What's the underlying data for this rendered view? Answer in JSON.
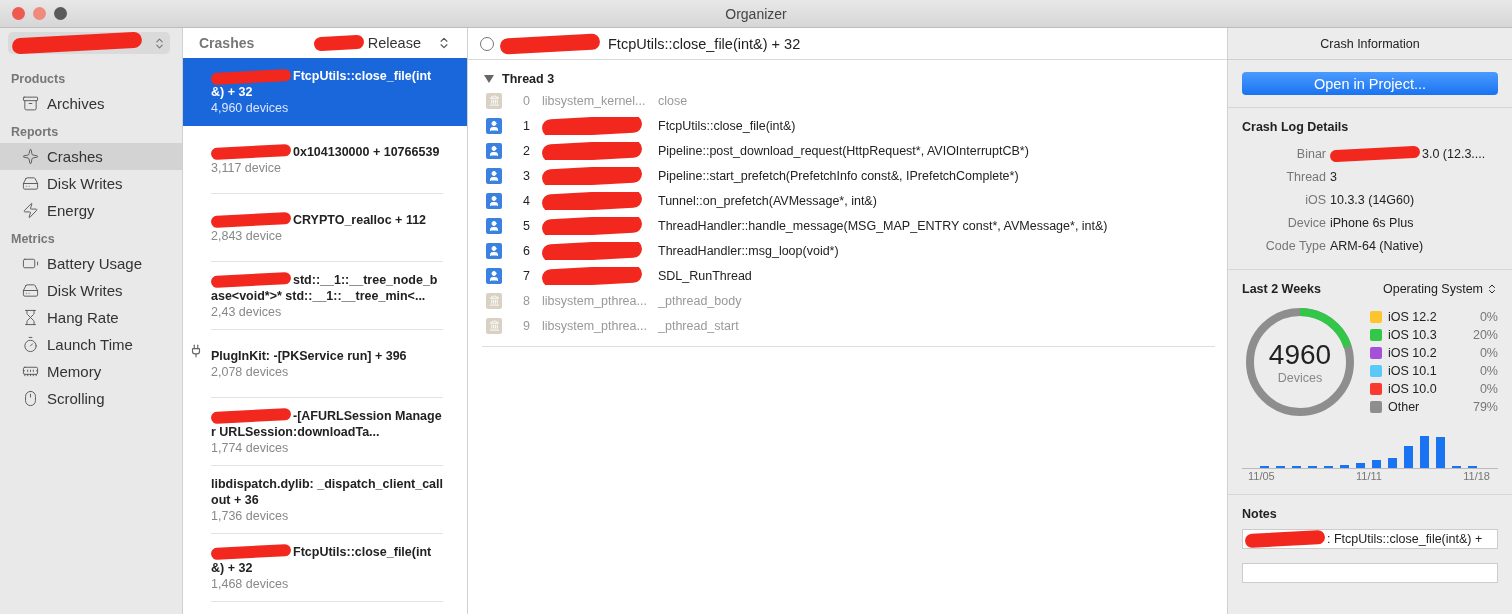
{
  "window": {
    "title": "Organizer",
    "buttons": [
      {
        "color": "#ee5a52"
      },
      {
        "color": "#f08a7c"
      },
      {
        "color": "#5a5a5a"
      }
    ]
  },
  "sidebar": {
    "scheme_popup": {
      "redacted": true
    },
    "sections": [
      {
        "title": "Products",
        "items": [
          {
            "label": "Archives",
            "kind": "archive",
            "selected": false
          }
        ]
      },
      {
        "title": "Reports",
        "items": [
          {
            "label": "Crashes",
            "kind": "crash",
            "selected": true
          },
          {
            "label": "Disk Writes",
            "kind": "disk",
            "selected": false
          },
          {
            "label": "Energy",
            "kind": "energy",
            "selected": false
          }
        ]
      },
      {
        "title": "Metrics",
        "items": [
          {
            "label": "Battery Usage",
            "kind": "battery",
            "selected": false
          },
          {
            "label": "Disk Writes",
            "kind": "disk",
            "selected": false
          },
          {
            "label": "Hang Rate",
            "kind": "hourglass",
            "selected": false
          },
          {
            "label": "Launch Time",
            "kind": "timer",
            "selected": false
          },
          {
            "label": "Memory",
            "kind": "memory",
            "selected": false
          },
          {
            "label": "Scrolling",
            "kind": "scroll",
            "selected": false
          }
        ]
      }
    ]
  },
  "crash_list": {
    "title": "Crashes",
    "filter": {
      "label": "Release",
      "redacted": true
    },
    "items": [
      {
        "title": "FtcpUtils::close_file(int&) + 32",
        "devices": "4,960 devices",
        "selected": true,
        "redacted": true
      },
      {
        "title": "0x104130000 + 10766539",
        "devices": "3,117 device",
        "selected": false,
        "redacted": true
      },
      {
        "title": "CRYPTO_realloc + 112",
        "devices": "2,843 device",
        "selected": false,
        "redacted": true
      },
      {
        "title": "std::__1::__tree_node_base<void*>* std::__1::__tree_min<...",
        "devices": "2,43 devices",
        "selected": false,
        "redacted": true
      },
      {
        "title": "PlugInKit: -[PKService run] + 396",
        "devices": "2,078 devices",
        "selected": false,
        "redacted": false,
        "plugin": true
      },
      {
        "title": "-[AFURLSession Manager URLSession:downloadTa...",
        "devices": "1,774 devices",
        "selected": false,
        "redacted": true
      },
      {
        "title": "libdispatch.dylib: _dispatch_client_callout + 36",
        "devices": "1,736 devices",
        "selected": false,
        "redacted": false
      },
      {
        "title": "FtcpUtils::close_file(int&) + 32",
        "devices": "1,468 devices",
        "selected": false,
        "redacted": true
      }
    ]
  },
  "detail": {
    "header": {
      "title": "FtcpUtils::close_file(int&) + 32",
      "redacted": true,
      "checked": false
    },
    "thread": {
      "title": "Thread 3",
      "expanded": true,
      "frames": [
        {
          "index": "0",
          "kind": "system",
          "library": "libsystem_kernel...",
          "symbol": "close"
        },
        {
          "index": "1",
          "kind": "user",
          "redacted": true,
          "symbol": "FtcpUtils::close_file(int&)"
        },
        {
          "index": "2",
          "kind": "user",
          "redacted": true,
          "symbol": "Pipeline::post_download_request(HttpRequest*, AVIOInterruptCB*)"
        },
        {
          "index": "3",
          "kind": "user",
          "redacted": true,
          "symbol": "Pipeline::start_prefetch(PrefetchInfo const&, IPrefetchComplete*)"
        },
        {
          "index": "4",
          "kind": "user",
          "redacted": true,
          "symbol": "Tunnel::on_prefetch(AVMessage*, int&)"
        },
        {
          "index": "5",
          "kind": "user",
          "redacted": true,
          "symbol": "ThreadHandler::handle_message(MSG_MAP_ENTRY const*, AVMessage*, int&)"
        },
        {
          "index": "6",
          "kind": "user",
          "redacted": true,
          "symbol": "ThreadHandler::msg_loop(void*)"
        },
        {
          "index": "7",
          "kind": "user",
          "redacted": true,
          "symbol": "SDL_RunThread"
        },
        {
          "index": "8",
          "kind": "system",
          "library": "libsystem_pthrea...",
          "symbol": "_pthread_body"
        },
        {
          "index": "9",
          "kind": "system",
          "library": "libsystem_pthrea...",
          "symbol": "_pthread_start"
        }
      ]
    }
  },
  "inspector": {
    "title": "Crash Information",
    "open_button": "Open in Project...",
    "details_title": "Crash Log Details",
    "details": [
      {
        "label": "Binar",
        "value": "3.0 (12.3....",
        "redacted": true
      },
      {
        "label": "Thread",
        "value": "3"
      },
      {
        "label": "iOS",
        "value": "10.3.3 (14G60)"
      },
      {
        "label": "Device",
        "value": "iPhone 6s Plus"
      },
      {
        "label": "Code Type",
        "value": "ARM-64 (Native)"
      }
    ],
    "stats": {
      "title": "Last 2 Weeks",
      "breakdown": "Operating System",
      "total": "4960",
      "total_label": "Devices",
      "legend": [
        {
          "label": "iOS 12.2",
          "value": "0%",
          "color": "#fcc42d"
        },
        {
          "label": "iOS 10.3",
          "value": "20%",
          "color": "#32c748"
        },
        {
          "label": "iOS 10.2",
          "value": "0%",
          "color": "#a550d8"
        },
        {
          "label": "iOS 10.1",
          "value": "0%",
          "color": "#5ac8fa"
        },
        {
          "label": "iOS 10.0",
          "value": "0%",
          "color": "#fa3a30"
        },
        {
          "label": "Other",
          "value": "79%",
          "color": "#8e8e8e"
        }
      ],
      "axis_labels": [
        "11/05",
        "11/11",
        "11/18"
      ]
    },
    "notes": {
      "title": "Notes",
      "value": ": FtcpUtils::close_file(int&) +",
      "redacted": true
    }
  }
}
